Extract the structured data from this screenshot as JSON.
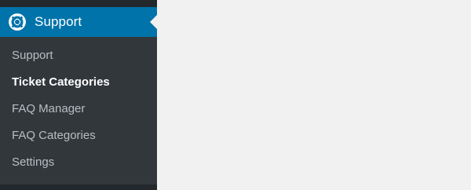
{
  "menu": {
    "title": "Support",
    "icon": "lifebuoy-icon",
    "accent_color": "#0073aa",
    "items": [
      {
        "label": "Support",
        "current": false
      },
      {
        "label": "Ticket Categories",
        "current": true
      },
      {
        "label": "FAQ Manager",
        "current": false
      },
      {
        "label": "FAQ Categories",
        "current": false
      },
      {
        "label": "Settings",
        "current": false
      }
    ]
  }
}
